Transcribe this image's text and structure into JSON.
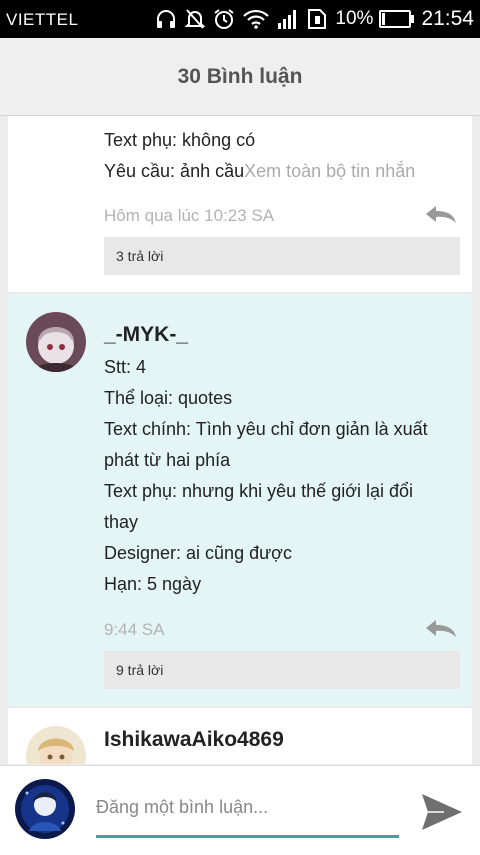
{
  "status_bar": {
    "carrier": "VIETTEL",
    "battery": "10%",
    "time": "21:54"
  },
  "header": {
    "title": "30 Bình luận"
  },
  "comments": [
    {
      "lines": [
        "Text phụ: không có"
      ],
      "last_line_text": "Yêu cầu: ảnh cầu",
      "expand_hint": "Xem toàn bộ tin nhắn",
      "time": "Hôm qua lúc 10:23 SA",
      "replies": "3 trả lời"
    },
    {
      "username": "_-MYK-_",
      "lines": [
        "Stt: 4",
        "Thể loại: quotes",
        "Text chính: Tình yêu chỉ đơn giản là xuất",
        "phát từ hai phía",
        "Text phụ: nhưng khi yêu thế giới lại đổi",
        "thay",
        "Designer: ai cũng được",
        "Hạn: 5 ngày"
      ],
      "time": "9:44 SA",
      "replies": "9 trả lời"
    },
    {
      "username": "IshikawaAiko4869"
    }
  ],
  "input": {
    "placeholder": "Đăng một bình luận..."
  },
  "icons": {
    "reply": "reply-arrow-icon",
    "send": "send-icon"
  },
  "colors": {
    "highlight_bg": "#e4f5f6",
    "input_underline": "#3aa6a6"
  }
}
